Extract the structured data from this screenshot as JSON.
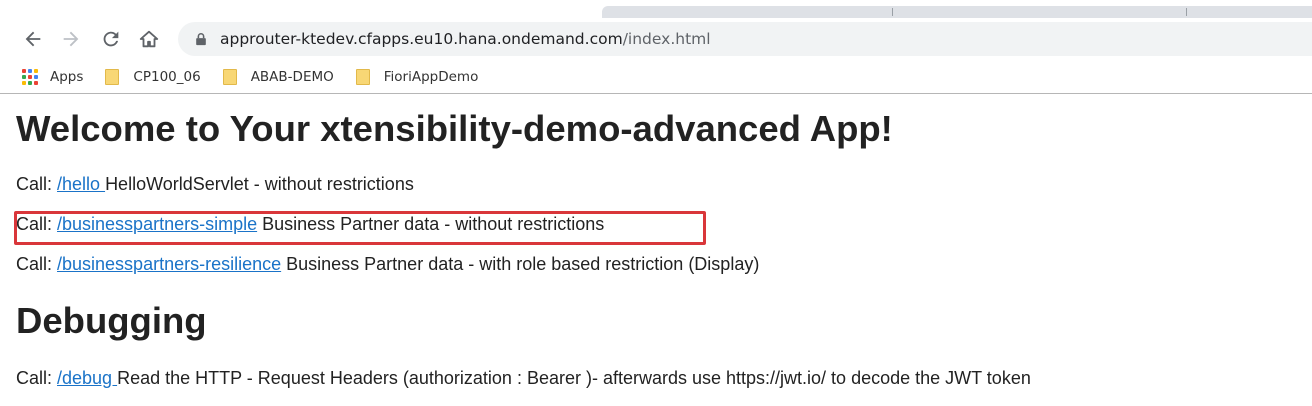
{
  "browser": {
    "url_host": "approuter-ktedev.cfapps.eu10.hana.ondemand.com",
    "url_path": "/index.html",
    "bookmarks": [
      {
        "label": "Apps",
        "icon": "apps-grid-icon"
      },
      {
        "label": "CP100_06",
        "icon": "folder-icon"
      },
      {
        "label": "ABAB-DEMO",
        "icon": "folder-icon"
      },
      {
        "label": "FioriAppDemo",
        "icon": "folder-icon"
      }
    ]
  },
  "page": {
    "title": "Welcome to Your xtensibility-demo-advanced App!",
    "calls": [
      {
        "prefix": "Call: ",
        "link": "/hello ",
        "desc": "HelloWorldServlet - without restrictions"
      },
      {
        "prefix": "Call: ",
        "link": "/businesspartners-simple",
        "desc": " Business Partner data - without restrictions"
      },
      {
        "prefix": "Call: ",
        "link": "/businesspartners-resilience",
        "desc": " Business Partner data - with role based restriction (Display)"
      }
    ],
    "debug_title": "Debugging",
    "debug_call": {
      "prefix": "Call: ",
      "link": "/debug ",
      "desc": "Read the HTTP - Request Headers (authorization : Bearer )- afterwards use https://jwt.io/ to decode the JWT token"
    }
  },
  "colors": {
    "link": "#1a73c8",
    "highlight_box": "#d9363a",
    "folder": "#f8d775"
  }
}
